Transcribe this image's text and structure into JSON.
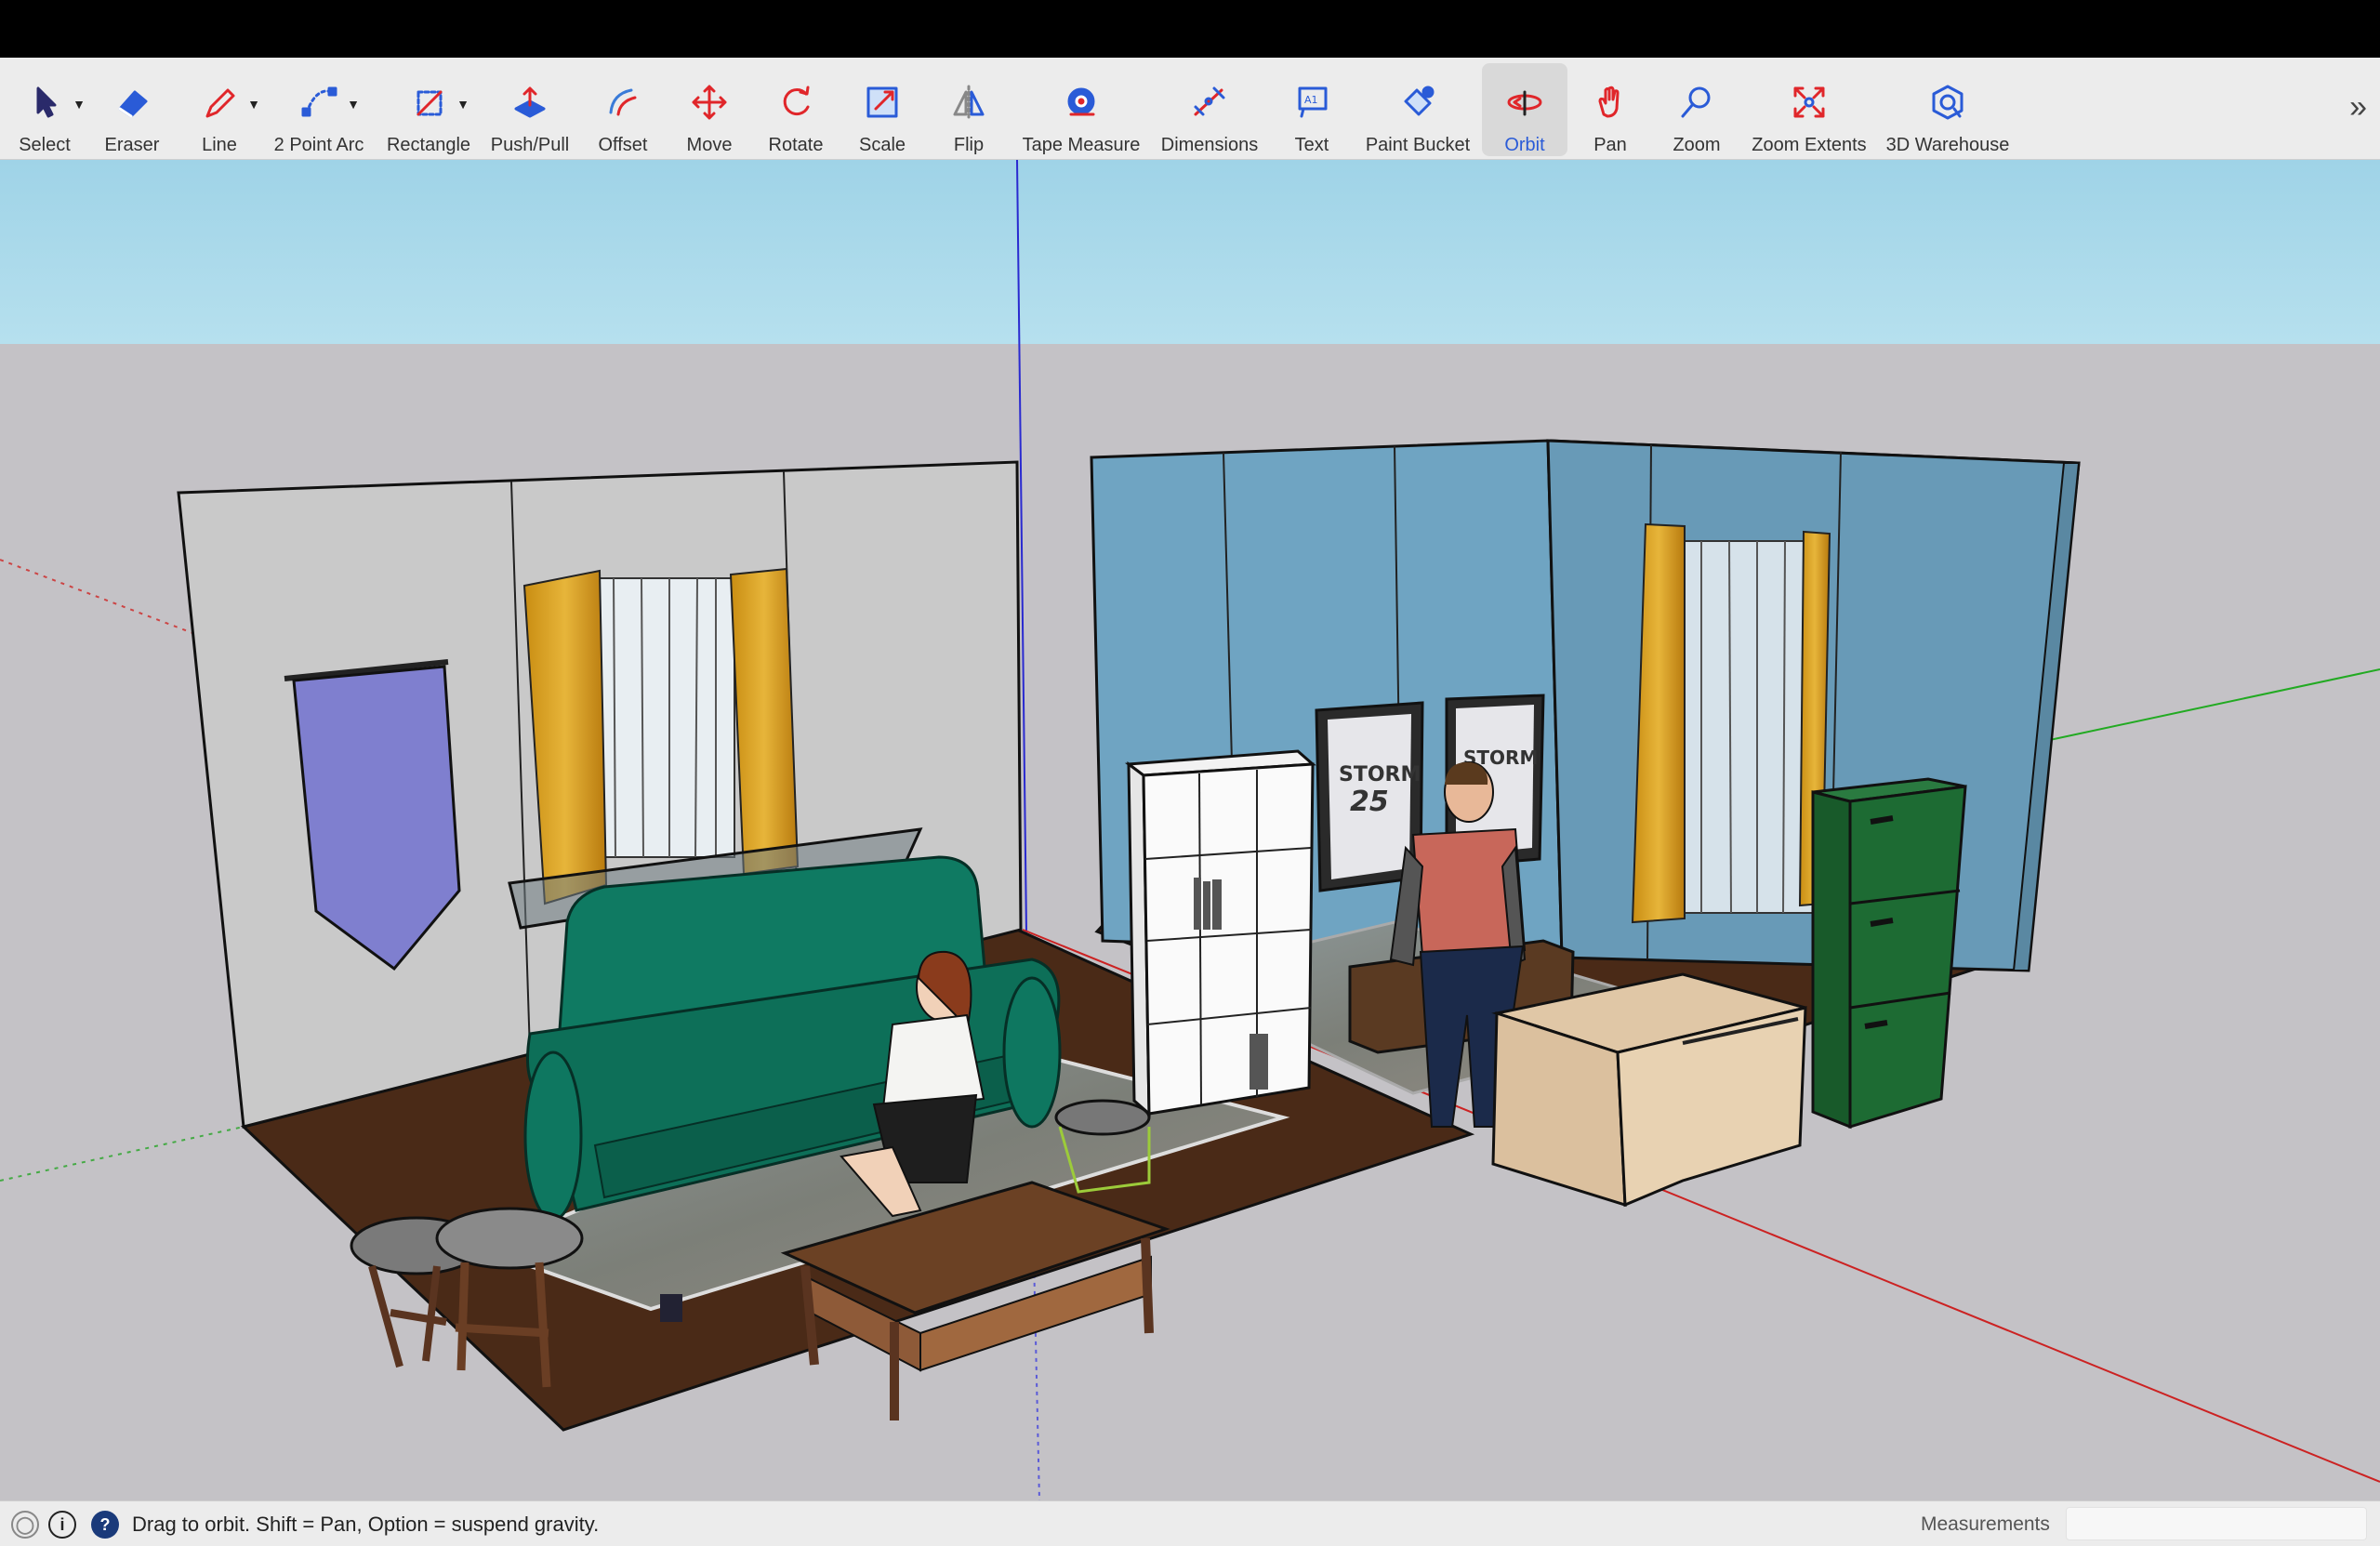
{
  "toolbar": {
    "tools": [
      {
        "id": "select",
        "label": "Select",
        "icon": "select-arrow-icon"
      },
      {
        "id": "eraser",
        "label": "Eraser",
        "icon": "eraser-icon"
      },
      {
        "id": "line",
        "label": "Line",
        "icon": "pencil-icon"
      },
      {
        "id": "arc",
        "label": "2 Point Arc",
        "icon": "arc-icon"
      },
      {
        "id": "rectangle",
        "label": "Rectangle",
        "icon": "rectangle-icon"
      },
      {
        "id": "pushpull",
        "label": "Push/Pull",
        "icon": "push-pull-icon"
      },
      {
        "id": "offset",
        "label": "Offset",
        "icon": "offset-icon"
      },
      {
        "id": "move",
        "label": "Move",
        "icon": "move-icon"
      },
      {
        "id": "rotate",
        "label": "Rotate",
        "icon": "rotate-icon"
      },
      {
        "id": "scale",
        "label": "Scale",
        "icon": "scale-icon"
      },
      {
        "id": "flip",
        "label": "Flip",
        "icon": "flip-icon"
      },
      {
        "id": "tape",
        "label": "Tape Measure",
        "icon": "tape-measure-icon"
      },
      {
        "id": "dimensions",
        "label": "Dimensions",
        "icon": "dimensions-icon"
      },
      {
        "id": "text",
        "label": "Text",
        "icon": "text-icon"
      },
      {
        "id": "paint",
        "label": "Paint Bucket",
        "icon": "paint-bucket-icon"
      },
      {
        "id": "orbit",
        "label": "Orbit",
        "icon": "orbit-icon",
        "active": true
      },
      {
        "id": "pan",
        "label": "Pan",
        "icon": "pan-hand-icon"
      },
      {
        "id": "zoom",
        "label": "Zoom",
        "icon": "zoom-icon"
      },
      {
        "id": "zoomext",
        "label": "Zoom Extents",
        "icon": "zoom-extents-icon"
      },
      {
        "id": "warehouse",
        "label": "3D Warehouse",
        "icon": "warehouse-icon"
      }
    ],
    "overflow_icon": "chevron-double-right-icon"
  },
  "scene": {
    "jersey_left_text": "STORM",
    "jersey_left_number": "25",
    "jersey_right_text": "STORM"
  },
  "status": {
    "message": "Drag to orbit. Shift = Pan, Option = suspend gravity.",
    "measurements_label": "Measurements",
    "measurements_value": ""
  },
  "colors": {
    "accent": "#2a5bd7",
    "sky": "#a9d8ea",
    "ground": "#c4c2c6",
    "floor": "#4a2a17",
    "left_wall": "#c8c8c8",
    "right_wall": "#6fa4c2",
    "sofa": "#0f7a62",
    "cabinet": "#1d6b33"
  }
}
